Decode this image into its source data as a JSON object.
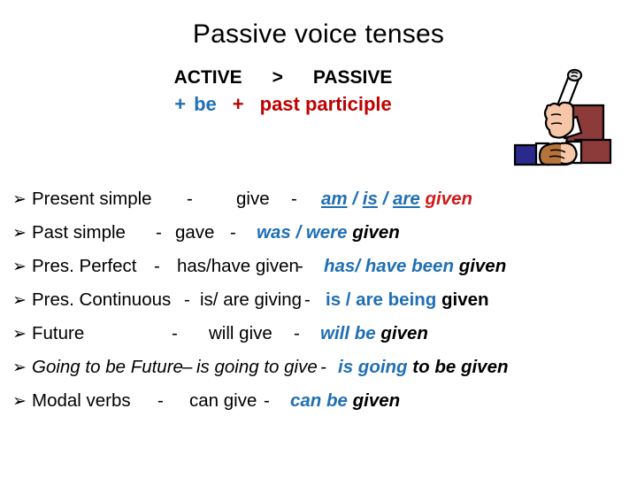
{
  "slide": {
    "title": "Passive voice tenses",
    "background_color": "#FFFFFF"
  },
  "colors": {
    "blue": "#1F6FB4",
    "red_body": "#D0191B",
    "red_header": "#C00000",
    "black": "#000000"
  },
  "header": {
    "active_label": "ACTIVE",
    "arrow": ">",
    "passive_label": "PASSIVE",
    "formula_plus_1": "+",
    "formula_be": "be",
    "formula_plus_2": "+",
    "formula_past_participle": "past participle"
  },
  "clipart": {
    "name": "hand-holding-diploma-and-handshake"
  },
  "list": {
    "bullet_glyph": "➢",
    "rows": [
      {
        "tense": "Present simple",
        "sep1": "-",
        "active": "give",
        "sep2": "-",
        "passive_aux": "am / is /are",
        "passive_aux_parts": [
          "am",
          "/",
          "is",
          "/",
          "are"
        ],
        "passive_participle": "given",
        "passive_aux_color": "blue",
        "passive_participle_color": "red",
        "passive_aux_style": "bold-italic-underline",
        "passive_participle_style": "bold-italic",
        "row_italic": false
      },
      {
        "tense": "Past simple",
        "sep1": "-",
        "active": "gave",
        "sep2": "-",
        "passive_aux": "was / were",
        "passive_participle": "given",
        "passive_aux_color": "blue",
        "passive_participle_color": "black",
        "passive_aux_style": "bold-italic",
        "passive_participle_style": "bold-italic",
        "row_italic": false
      },
      {
        "tense": "Pres. Perfect",
        "sep1": "-",
        "active": "has/have given",
        "sep2": "-",
        "passive_aux": "has/ have been",
        "passive_participle": "given",
        "passive_aux_color": "blue",
        "passive_participle_color": "black",
        "passive_aux_style": "bold-italic",
        "passive_participle_style": "bold-italic",
        "row_italic": false
      },
      {
        "tense": "Pres. Continuous",
        "sep1": "-",
        "active": "is/ are giving",
        "sep2": "-",
        "passive_aux": "is / are being",
        "passive_participle": "given",
        "passive_aux_color": "blue",
        "passive_participle_color": "black",
        "passive_aux_style": "bold",
        "passive_participle_style": "bold",
        "row_italic": false
      },
      {
        "tense": "Future",
        "sep1": "-",
        "active": "will give",
        "sep2": "-",
        "passive_aux": "will be",
        "passive_participle": "given",
        "passive_aux_color": "blue",
        "passive_participle_color": "black",
        "passive_aux_style": "bold-italic",
        "passive_participle_style": "bold-italic",
        "row_italic": false
      },
      {
        "tense": "Going to be Future",
        "sep1": "–",
        "active": "is going to give",
        "sep2": "-",
        "passive_aux": "is going",
        "passive_participle": "to be given",
        "passive_aux_color": "blue",
        "passive_participle_color": "black",
        "passive_aux_style": "bold-italic",
        "passive_participle_style": "bold-italic",
        "row_italic": true
      },
      {
        "tense": "Modal verbs",
        "sep1": "-",
        "active": "can give",
        "sep2": "-",
        "passive_aux": "can be",
        "passive_participle": "given",
        "passive_aux_color": "blue",
        "passive_participle_color": "black",
        "passive_aux_style": "bold-italic",
        "passive_participle_style": "bold-italic",
        "row_italic": false
      }
    ]
  }
}
